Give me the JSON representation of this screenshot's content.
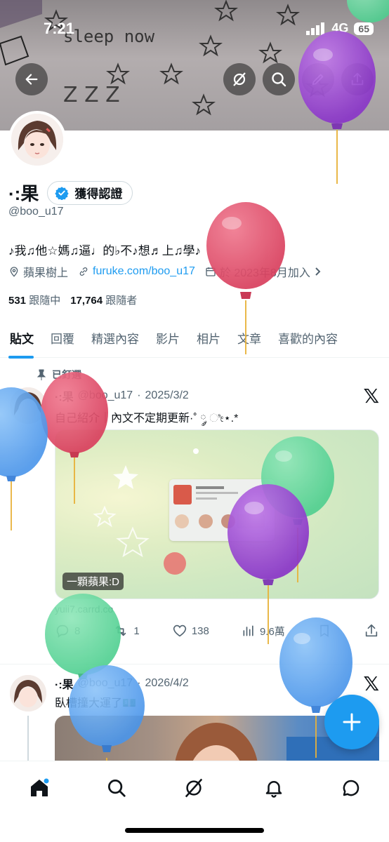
{
  "status_bar": {
    "time": "7:21",
    "network": "4G",
    "battery": "65"
  },
  "banner": {
    "scribble_text": "sleep now",
    "zzz": "ZZZ"
  },
  "profile": {
    "name": "·:果",
    "verify_label": "獲得認證",
    "handle": "@boo_u17",
    "bio": "♪我♫他☆媽♫逼♩的♭不♪想♬上♫學♪",
    "location": "蘋果樹上",
    "website": "furuke.com/boo_u17",
    "joined": "於 2023年8月加入",
    "following_count": "531",
    "following_label": "跟隨中",
    "followers_count": "17,764",
    "followers_label": "跟隨者"
  },
  "tabs": [
    {
      "label": "貼文"
    },
    {
      "label": "回覆"
    },
    {
      "label": "精選內容"
    },
    {
      "label": "影片"
    },
    {
      "label": "相片"
    },
    {
      "label": "文章"
    },
    {
      "label": "喜歡的內容"
    }
  ],
  "posts": [
    {
      "pinned_label": "已釘選",
      "name": "·:果",
      "handle": "@boo_u17",
      "date": "2025/3/2",
      "text": "自己紹介｜內文不定期更新·˚ ༘ ೀ⋆.*",
      "image_caption": "一顆蘋果:D",
      "link_domain": "yuii7.carrd.co",
      "replies": "8",
      "reposts": "1",
      "likes": "138",
      "views": "9.6萬"
    },
    {
      "name": "·:果",
      "handle": "@boo_u17",
      "date": "2026/4/2",
      "text": "臥槽撞大運了💵"
    }
  ],
  "colors": {
    "accent": "#1d9bf0",
    "text": "#0f1419",
    "muted": "#536471"
  },
  "icons": [
    "back-icon",
    "grok-icon",
    "search-icon",
    "edit-icon",
    "share-icon",
    "home-icon",
    "explore-icon",
    "grok-nav-icon",
    "notifications-icon",
    "messages-icon"
  ]
}
